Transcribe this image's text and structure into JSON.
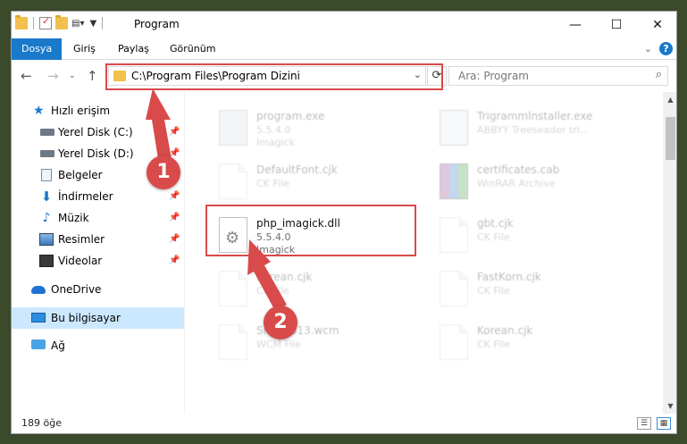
{
  "window": {
    "title": "Program"
  },
  "ribbon": {
    "tabs": [
      {
        "label": "Dosya",
        "active": true
      },
      {
        "label": "Giriş",
        "active": false
      },
      {
        "label": "Paylaş",
        "active": false
      },
      {
        "label": "Görünüm",
        "active": false
      }
    ],
    "help": "?"
  },
  "address": {
    "path": "C:\\Program Files\\Program Dizini",
    "dropdown": "⌄",
    "refresh": "⟳"
  },
  "search": {
    "placeholder": "Ara: Program",
    "icon": "search-icon"
  },
  "sidebar": {
    "items": [
      {
        "label": "Hızlı erişim",
        "icon": "star-icon",
        "pinned": false
      },
      {
        "label": "Yerel Disk (C:)",
        "icon": "disk-icon",
        "pinned": true
      },
      {
        "label": "Yerel Disk (D:)",
        "icon": "disk-icon",
        "pinned": true
      },
      {
        "label": "Belgeler",
        "icon": "documents-icon",
        "pinned": true
      },
      {
        "label": "İndirmeler",
        "icon": "downloads-icon",
        "pinned": true
      },
      {
        "label": "Müzik",
        "icon": "music-icon",
        "pinned": true
      },
      {
        "label": "Resimler",
        "icon": "pictures-icon",
        "pinned": true
      },
      {
        "label": "Videolar",
        "icon": "videos-icon",
        "pinned": true
      },
      {
        "label": "OneDrive",
        "icon": "onedrive-icon",
        "pinned": false
      },
      {
        "label": "Bu bilgisayar",
        "icon": "this-pc-icon",
        "pinned": false,
        "selected": true
      },
      {
        "label": "Ağ",
        "icon": "network-icon",
        "pinned": false
      }
    ]
  },
  "files": [
    {
      "name": "program.exe",
      "line2": "5.5.4.0",
      "line3": "Imagick",
      "icon": "exe-icon",
      "dim": true
    },
    {
      "name": "Trigrammlnstaller.exe",
      "line2": "ABBYY Treeseader tri...",
      "line3": "",
      "icon": "app-icon",
      "dim": true
    },
    {
      "name": "DefaultFont.cjk",
      "line2": "CK File",
      "line3": "",
      "icon": "file-icon",
      "dim": true
    },
    {
      "name": "certificates.cab",
      "line2": "WinRAR Archive",
      "line3": "",
      "icon": "rar-icon",
      "dim": true
    },
    {
      "name": "php_imagick.dll",
      "line2": "5.5.4.0",
      "line3": "Imagick",
      "icon": "dll-icon",
      "dim": false
    },
    {
      "name": "gbt.cjk",
      "line2": "CK File",
      "line3": "",
      "icon": "file-icon",
      "dim": true
    },
    {
      "name": "Korean.cjk",
      "line2": "CK File",
      "line3": "",
      "icon": "file-icon",
      "dim": true
    },
    {
      "name": "FastKorn.cjk",
      "line2": "CK File",
      "line3": "",
      "icon": "file-icon",
      "dim": true
    },
    {
      "name": "Snap0313.wcm",
      "line2": "WCM File",
      "line3": "",
      "icon": "file-icon",
      "dim": true
    },
    {
      "name": "Korean.cjk",
      "line2": "CK File",
      "line3": "",
      "icon": "file-icon",
      "dim": true
    }
  ],
  "status": {
    "count": "189 öğe"
  },
  "annotations": {
    "step1": "1",
    "step2": "2",
    "color": "#d94a4a"
  }
}
